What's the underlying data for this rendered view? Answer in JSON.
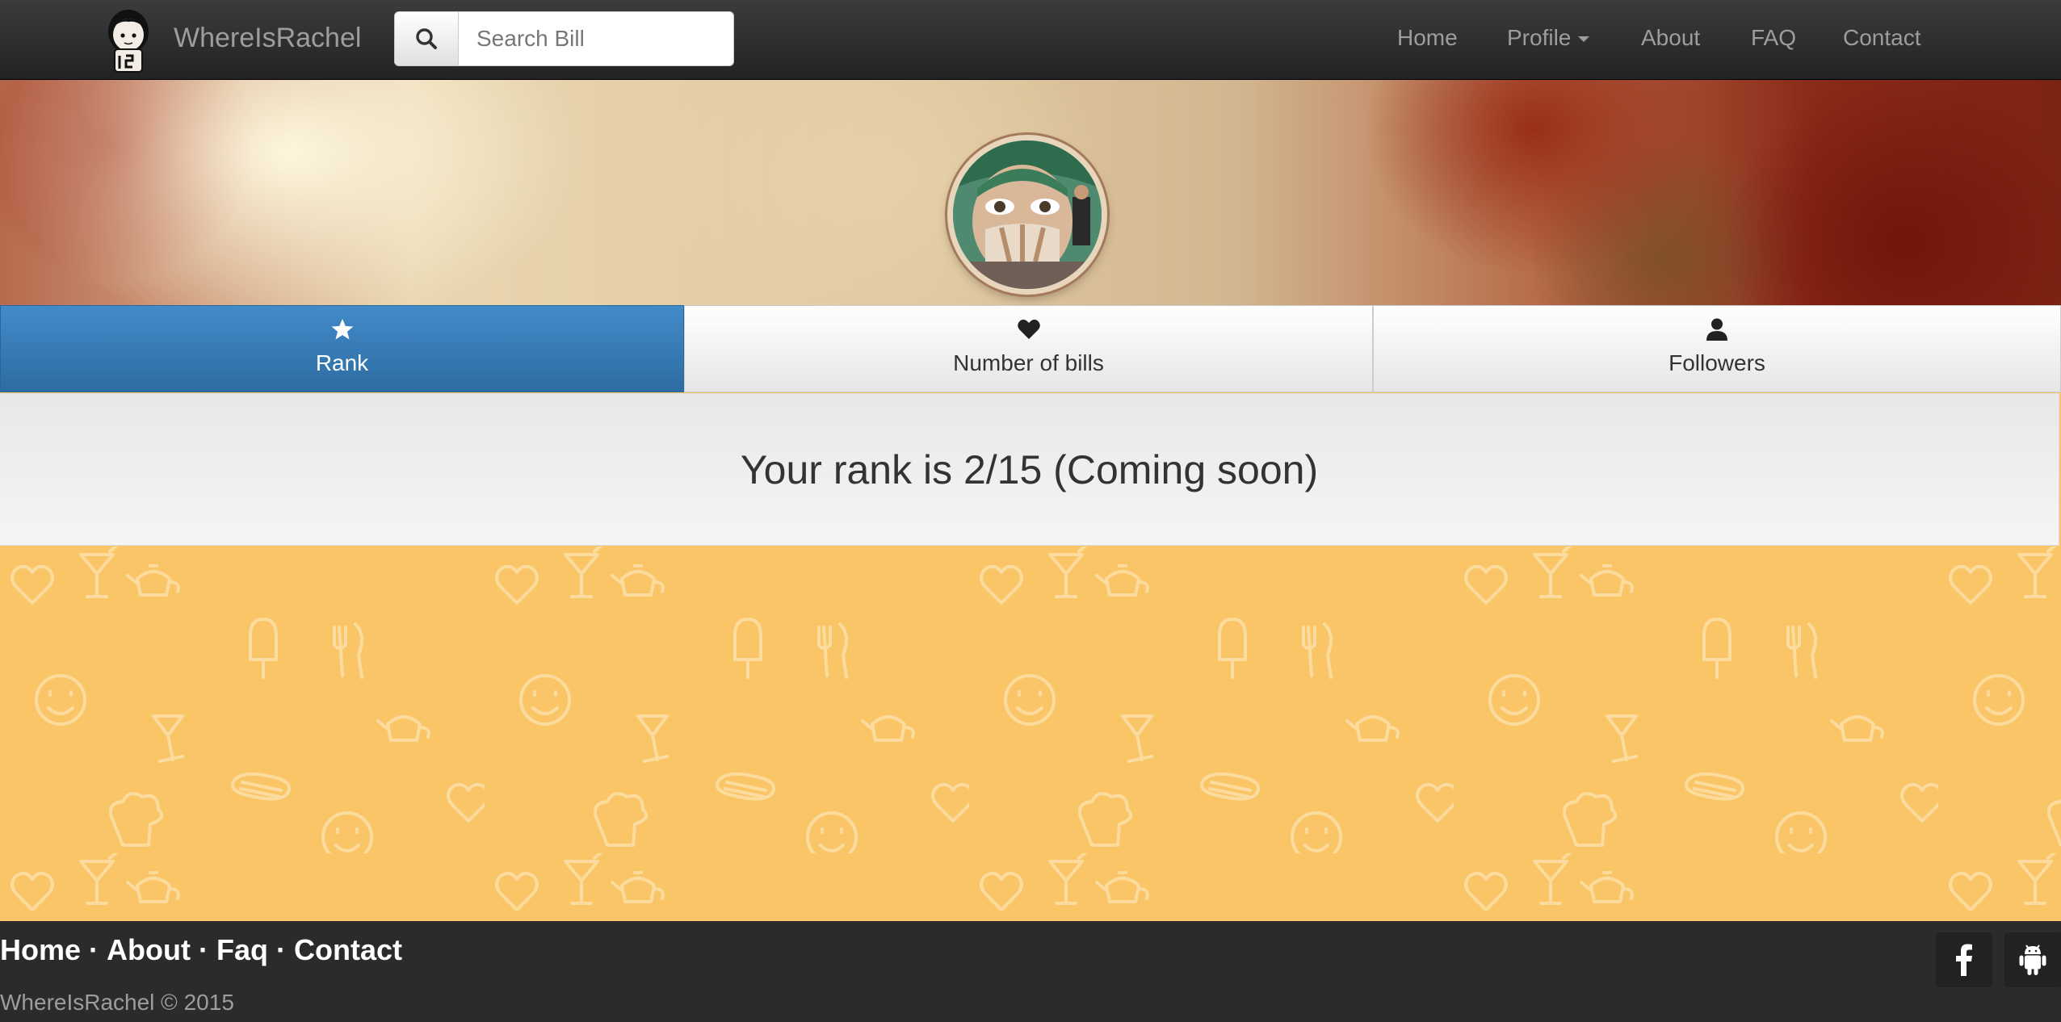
{
  "navbar": {
    "brand": "WhereIsRachel",
    "search": {
      "placeholder": "Search Bill",
      "value": ""
    },
    "links": {
      "home": "Home",
      "profile": "Profile",
      "about": "About",
      "faq": "FAQ",
      "contact": "Contact"
    }
  },
  "tabs": [
    {
      "label": "Rank",
      "icon": "star-icon",
      "active": true
    },
    {
      "label": "Number of bills",
      "icon": "heart-icon",
      "active": false
    },
    {
      "label": "Followers",
      "icon": "user-icon",
      "active": false
    }
  ],
  "panel": {
    "text": "Your rank is 2/15 (Coming soon)"
  },
  "footer": {
    "links": [
      "Home",
      "About",
      "Faq",
      "Contact"
    ],
    "separator": "·",
    "copyright": "WhereIsRachel © 2015",
    "social": [
      "facebook-icon",
      "android-icon"
    ]
  },
  "colors": {
    "navbar": "#222222",
    "active_tab": "#337ab7",
    "page_background": "#fac566",
    "footer": "#2b2b2b"
  }
}
